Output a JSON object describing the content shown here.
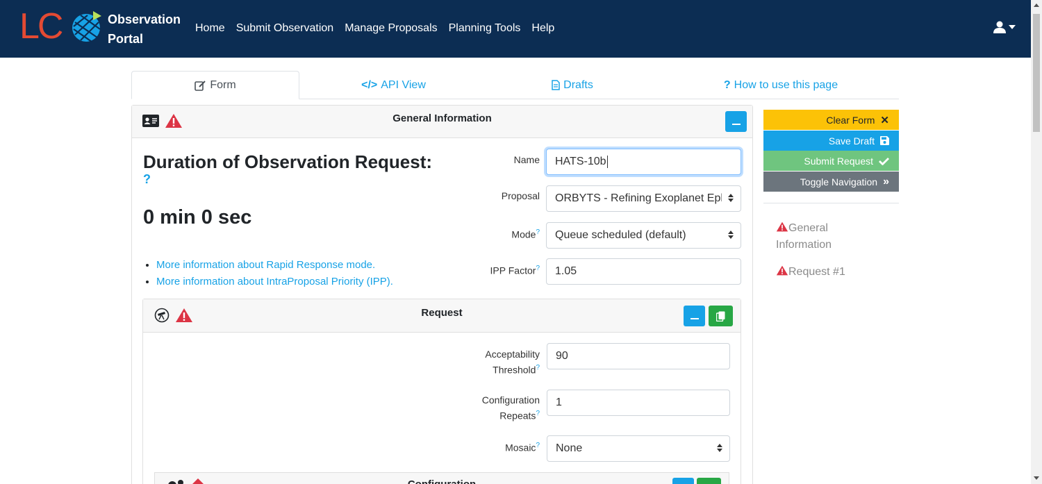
{
  "navbar": {
    "logo_text": "LC",
    "brand_line1": "Observation",
    "brand_line2": "Portal",
    "links": [
      "Home",
      "Submit Observation",
      "Manage Proposals",
      "Planning Tools",
      "Help"
    ],
    "bg_color": "#0c2d53"
  },
  "tabs": [
    {
      "label": "Form",
      "icon": "edit-icon",
      "active": true
    },
    {
      "label": "API View",
      "icon": "code-icon",
      "active": false
    },
    {
      "label": "Drafts",
      "icon": "file-icon",
      "active": false
    },
    {
      "label": "How to use this page",
      "icon": "question-icon",
      "active": false
    }
  ],
  "general": {
    "title": "General Information",
    "duration_title": "Duration of Observation Request:",
    "duration_help": "?",
    "duration_value": "0 min 0 sec",
    "links": [
      "More information about Rapid Response mode.",
      "More information about IntraProposal Priority (IPP)."
    ],
    "fields": {
      "name": {
        "label": "Name",
        "value": "HATS-10b"
      },
      "proposal": {
        "label": "Proposal",
        "value": "ORBYTS - Refining Exoplanet Eph"
      },
      "mode": {
        "label": "Mode",
        "value": "Queue scheduled (default)"
      },
      "ipp": {
        "label": "IPP Factor",
        "value": "1.05"
      }
    }
  },
  "request": {
    "title": "Request",
    "fields": {
      "acceptability_l1": "Acceptability",
      "acceptability_l2": "Threshold",
      "acceptability_value": "90",
      "config_l1": "Configuration",
      "config_l2": "Repeats",
      "config_value": "1",
      "mosaic_label": "Mosaic",
      "mosaic_value": "None"
    }
  },
  "configuration": {
    "title": "Configuration"
  },
  "sidebar": {
    "clear": "Clear Form",
    "save": "Save Draft",
    "submit": "Submit Request",
    "toggle": "Toggle Navigation",
    "nav_general_l1": "General",
    "nav_general_l2": "Information",
    "nav_request": "Request #1"
  },
  "help_mark": "?",
  "colors": {
    "accent": "#17a2e6",
    "warning": "#dc3545",
    "success": "#28a745",
    "yellow": "#fcc207"
  }
}
